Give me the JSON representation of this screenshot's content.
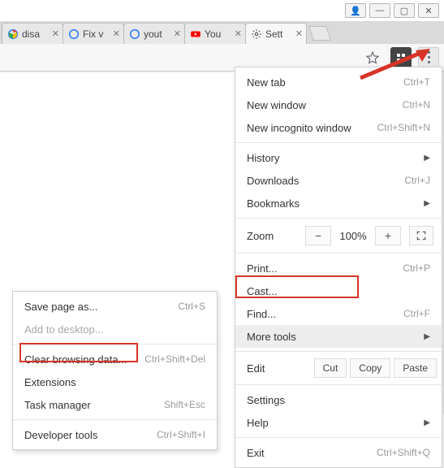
{
  "window_controls": {
    "user": "👤",
    "min": "—",
    "max": "▢",
    "close": "✕"
  },
  "tabs": [
    {
      "title": "disa",
      "icon": "g"
    },
    {
      "title": "Fix v",
      "icon": "g"
    },
    {
      "title": "yout",
      "icon": "g"
    },
    {
      "title": "You",
      "icon": "yt"
    },
    {
      "title": "Sett",
      "icon": "gear",
      "active": true
    }
  ],
  "menu": {
    "new_tab": {
      "label": "New tab",
      "shortcut": "Ctrl+T"
    },
    "new_window": {
      "label": "New window",
      "shortcut": "Ctrl+N"
    },
    "incognito": {
      "label": "New incognito window",
      "shortcut": "Ctrl+Shift+N"
    },
    "history": {
      "label": "History"
    },
    "downloads": {
      "label": "Downloads",
      "shortcut": "Ctrl+J"
    },
    "bookmarks": {
      "label": "Bookmarks"
    },
    "zoom": {
      "label": "Zoom",
      "minus": "−",
      "value": "100%",
      "plus": "+"
    },
    "print": {
      "label": "Print...",
      "shortcut": "Ctrl+P"
    },
    "cast": {
      "label": "Cast..."
    },
    "find": {
      "label": "Find...",
      "shortcut": "Ctrl+F"
    },
    "more_tools": {
      "label": "More tools"
    },
    "edit": {
      "label": "Edit",
      "cut": "Cut",
      "copy": "Copy",
      "paste": "Paste"
    },
    "settings": {
      "label": "Settings"
    },
    "help": {
      "label": "Help"
    },
    "exit": {
      "label": "Exit",
      "shortcut": "Ctrl+Shift+Q"
    }
  },
  "submenu": {
    "save_page": {
      "label": "Save page as...",
      "shortcut": "Ctrl+S"
    },
    "add_desktop": {
      "label": "Add to desktop..."
    },
    "clear_data": {
      "label": "Clear browsing data...",
      "shortcut": "Ctrl+Shift+Del"
    },
    "extensions": {
      "label": "Extensions"
    },
    "task_manager": {
      "label": "Task manager",
      "shortcut": "Shift+Esc"
    },
    "dev_tools": {
      "label": "Developer tools",
      "shortcut": "Ctrl+Shift+I"
    }
  }
}
